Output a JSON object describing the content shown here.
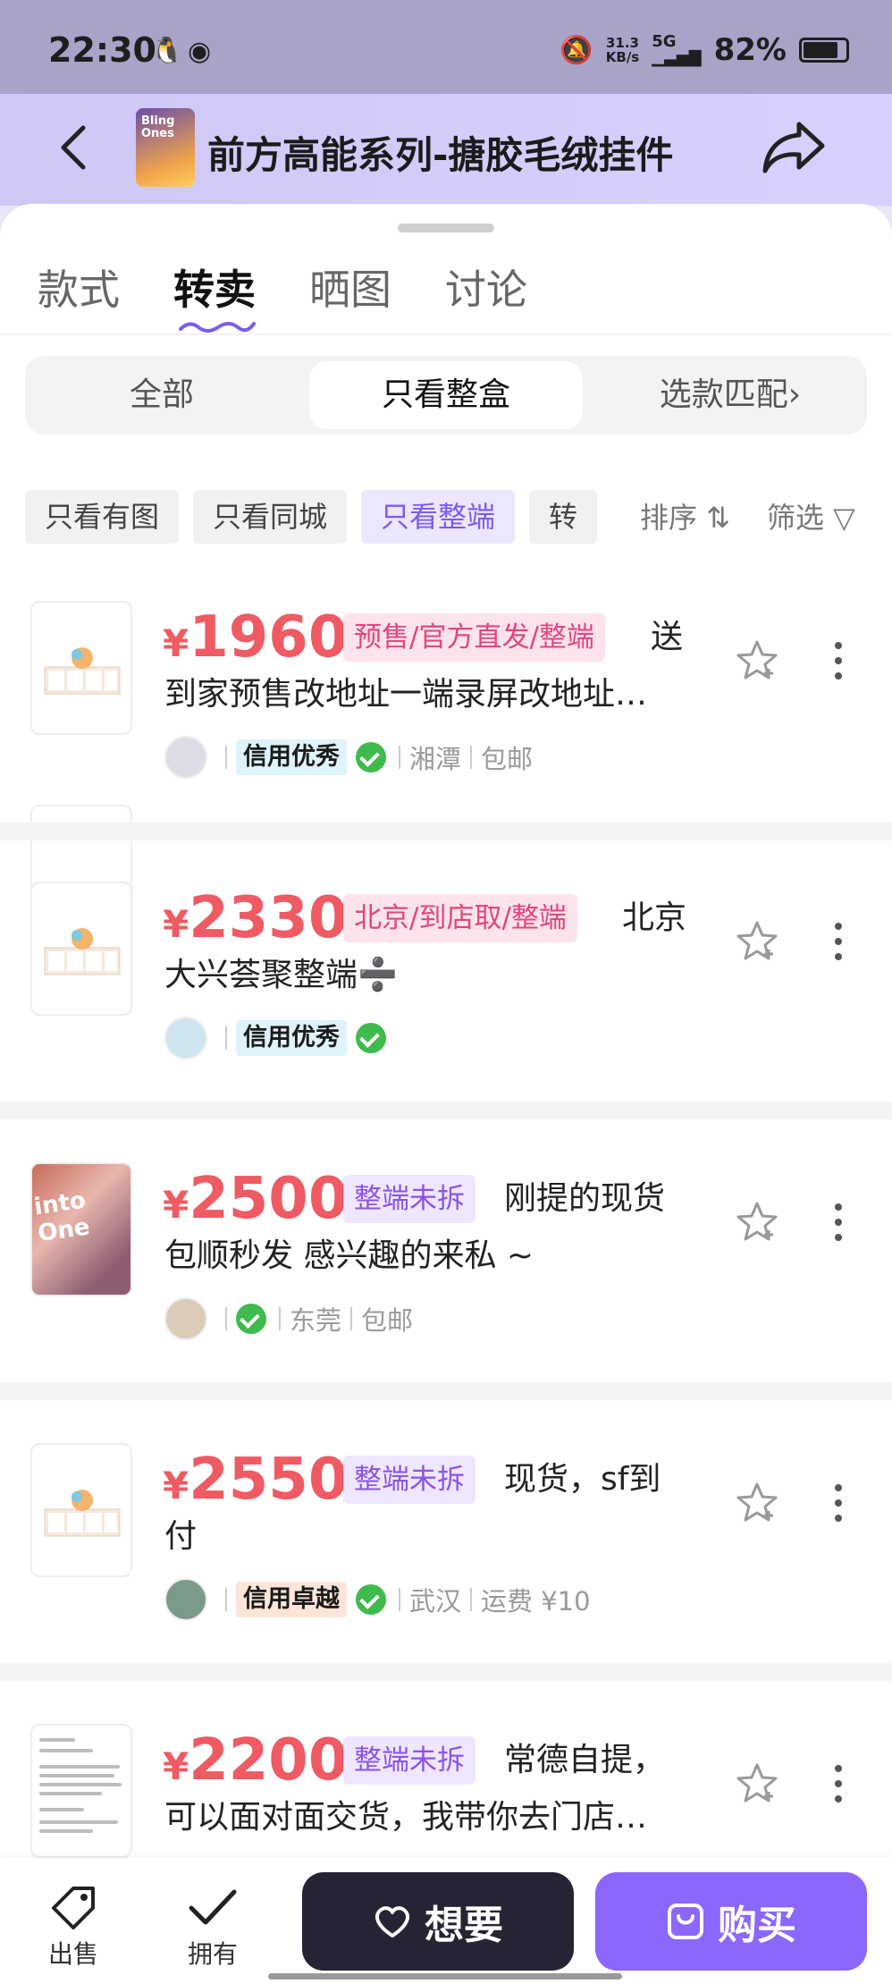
{
  "status_bar": {
    "time": "22:30",
    "net_speed_top": "31.3",
    "net_speed_bottom": "KB/s",
    "signal": "5G",
    "battery": "82%"
  },
  "header": {
    "title": "前方高能系列-搪胶毛绒挂件",
    "thumb_text": "Bling Ones"
  },
  "tabs": [
    "款式",
    "转卖",
    "晒图",
    "讨论"
  ],
  "segments": [
    "全部",
    "只看整盒",
    "选款匹配›"
  ],
  "chips": [
    "只看有图",
    "只看同城",
    "只看整端",
    "转"
  ],
  "sort_label": "排序 ⇅",
  "filter_label": "筛选 ▽",
  "currency": "¥",
  "listings": [
    {
      "price": "1960",
      "tag": "预售/官方直发/整端",
      "desc1": "送",
      "desc2": "到家预售改地址一端录屏改地址…",
      "credit": "信用优秀",
      "city": "湘潭",
      "shipping": "包邮"
    },
    {
      "price": "2330",
      "tag": "北京/到店取/整端",
      "desc1": "北京",
      "desc2": "大兴荟聚整端➗",
      "credit": "信用优秀",
      "city": "",
      "shipping": ""
    },
    {
      "price": "2500",
      "tag": "整端未拆",
      "desc1": "刚提的现货",
      "desc2": "包顺秒发 感兴趣的来私 ~",
      "credit": "",
      "city": "东莞",
      "shipping": "包邮",
      "photo_text": "into One"
    },
    {
      "price": "2550",
      "tag": "整端未拆",
      "desc1": "现货，sf到",
      "desc2": "付",
      "credit": "信用卓越",
      "city": "武汉",
      "shipping": "运费 ¥10"
    },
    {
      "price": "2200",
      "tag": "整端未拆",
      "desc1": "常德自提，",
      "desc2": "可以面对面交货，我带你去门店…",
      "credit": "",
      "city": "",
      "shipping": ""
    }
  ],
  "bottom_bar": {
    "sell": "出售",
    "own": "拥有",
    "want": "想要",
    "buy": "购买"
  },
  "colors": {
    "price": "#ef5a63",
    "accent": "#8b66ff",
    "dark_button": "#262334",
    "wechat": "#3fba4c"
  }
}
